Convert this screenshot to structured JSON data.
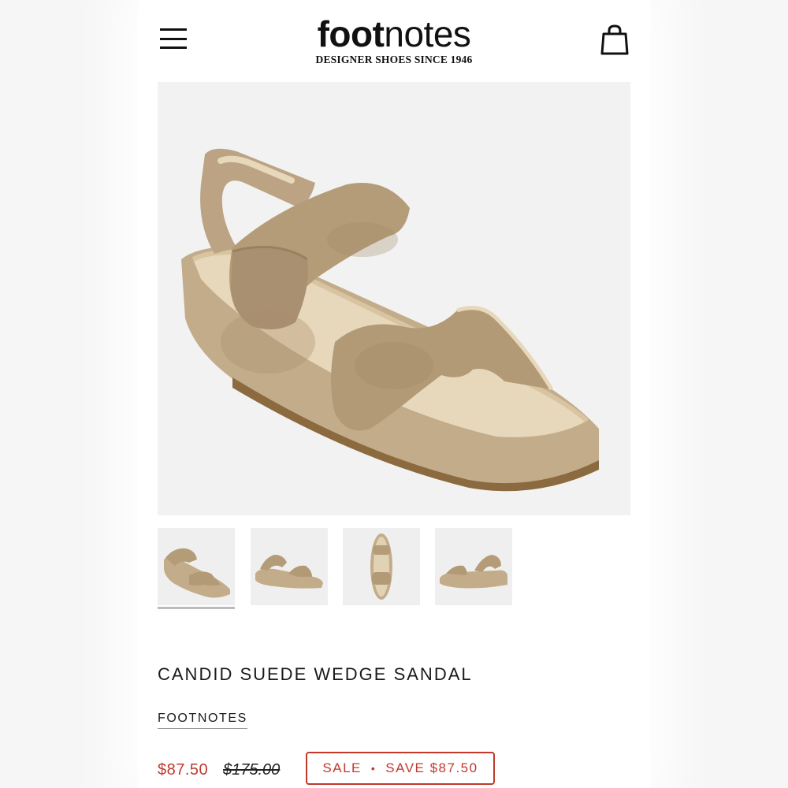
{
  "header": {
    "logo_bold": "foot",
    "logo_light": "notes",
    "tagline": "DESIGNER SHOES SINCE 1946",
    "menu_icon": "hamburger-menu-icon",
    "bag_icon": "shopping-bag-icon"
  },
  "product": {
    "title": "CANDID SUEDE WEDGE SANDAL",
    "brand": "FOOTNOTES",
    "sale_price": "$87.50",
    "original_price": "$175.00",
    "badge_sale": "SALE",
    "badge_separator": "•",
    "badge_save": "SAVE $87.50",
    "active_thumbnail": 0,
    "thumbnail_count": 4
  },
  "colors": {
    "accent_red": "#c0392b",
    "suede": "#bfa888",
    "suede_dark": "#a48c6a",
    "lining": "#e6d6b8"
  }
}
